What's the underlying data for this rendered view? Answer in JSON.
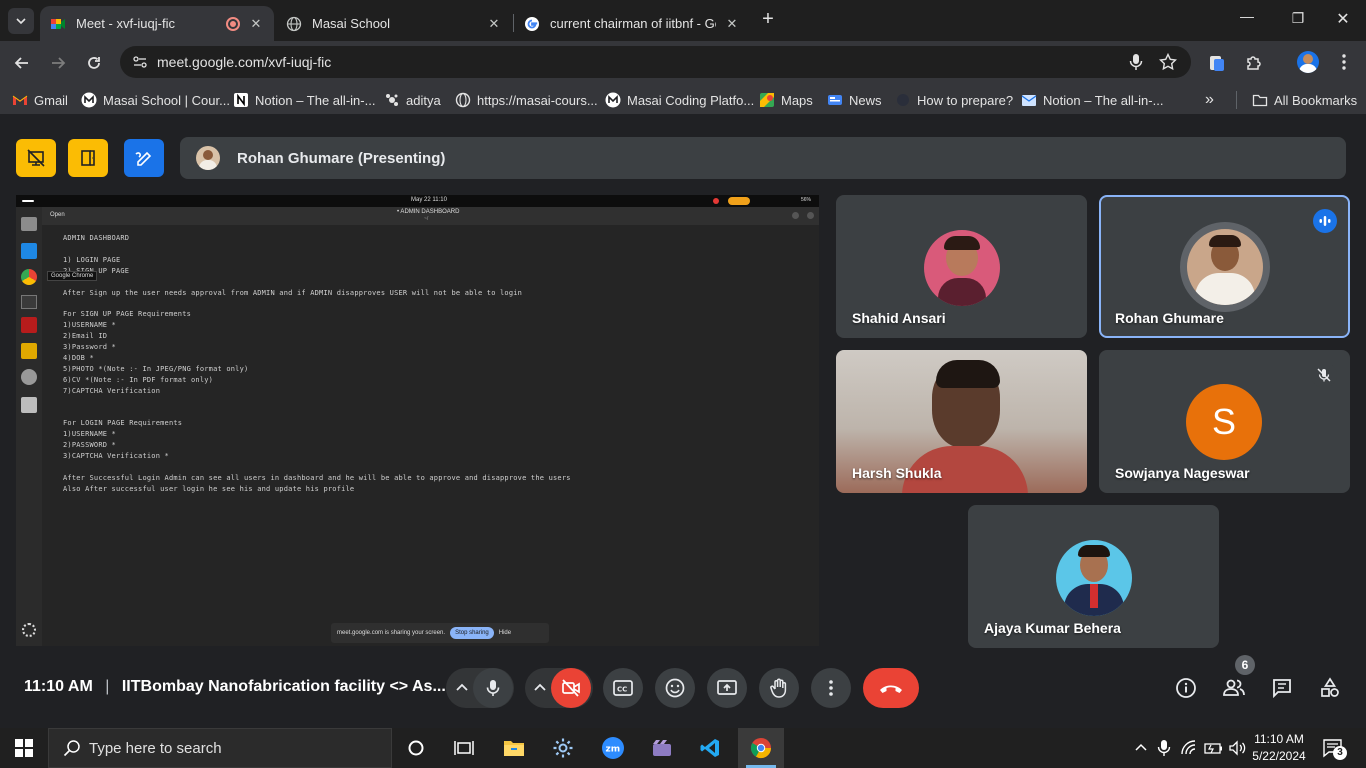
{
  "browser": {
    "tabs": [
      {
        "title": "Meet - xvf-iuqj-fic",
        "active": true,
        "recording": true
      },
      {
        "title": "Masai School",
        "active": false
      },
      {
        "title": "current chairman of iitbnf - Goo",
        "active": false
      }
    ],
    "new_tab": "+",
    "window_controls": {
      "minimize": "—",
      "restore": "❐",
      "close": "✕"
    },
    "url": "meet.google.com/xvf-iuqj-fic",
    "bookmarks": [
      {
        "label": "Gmail",
        "icon": "gmail-icon"
      },
      {
        "label": "Masai School | Cour...",
        "icon": "masai-icon"
      },
      {
        "label": "Notion – The all-in-...",
        "icon": "notion-icon"
      },
      {
        "label": "aditya",
        "icon": "aditya-icon"
      },
      {
        "label": "https://masai-cours...",
        "icon": "globe-icon"
      },
      {
        "label": "Masai Coding Platfo...",
        "icon": "masai-icon"
      },
      {
        "label": "Maps",
        "icon": "maps-icon"
      },
      {
        "label": "News",
        "icon": "news-icon"
      },
      {
        "label": "How to prepare?",
        "icon": "dark-circle-icon"
      },
      {
        "label": "Notion – The all-in-...",
        "icon": "mail-icon"
      }
    ],
    "bookmarks_overflow": "»",
    "all_bookmarks": "All Bookmarks"
  },
  "meet": {
    "presenter_label": "Rohan Ghumare (Presenting)",
    "shared_screen": {
      "os_clock": "May 22  11:10",
      "battery": "56%",
      "window_title": "• ADMIN DASHBOARD",
      "window_subtitle": "~/",
      "open_label": "Open",
      "tooltip": "Google Chrome",
      "lines": [
        "ADMIN DASHBOARD",
        "",
        "1) LOGIN PAGE",
        "2) SIGN UP PAGE",
        "",
        "After Sign up the user needs approval from ADMIN and if ADMIN disapproves USER will not be able to login",
        "",
        "For SIGN UP PAGE Requirements",
        "1)USERNAME *",
        "2)Email ID",
        "3)Password *",
        "4)DOB *",
        "5)PHOTO *(Note :- In JPEG/PNG format only)",
        "6)CV *(Note :- In PDF format only)",
        "7)CAPTCHA Verification",
        "",
        "",
        "For LOGIN PAGE Requirements",
        "1)USERNAME *",
        "2)PASSWORD *",
        "3)CAPTCHA Verification *",
        "",
        "After Successful Login Admin can see all users in dashboard and he will be able to approve and disapprove the users",
        "Also After successful user login he see his and update his profile"
      ],
      "sharing_notice": "meet.google.com is sharing your screen.",
      "stop_sharing": "Stop sharing",
      "hide": "Hide"
    },
    "participants": [
      {
        "name": "Shahid Ansari"
      },
      {
        "name": "Rohan Ghumare",
        "speaking": true
      },
      {
        "name": "Harsh Shukla"
      },
      {
        "name": "Sowjanya Nageswar",
        "initial": "S",
        "muted": true
      },
      {
        "name": "Ajaya Kumar Behera"
      }
    ],
    "time": "11:10 AM",
    "separator": "|",
    "meeting_title": "IITBombay Nanofabrication facility <> As...",
    "people_count": "6"
  },
  "taskbar": {
    "search_placeholder": "Type here to search",
    "clock_time": "11:10 AM",
    "clock_date": "5/22/2024",
    "notification_count": "3"
  },
  "colors": {
    "hangup": "#ea4335",
    "speaking_border": "#8ab4f8",
    "yellow_button": "#fbbc04",
    "blue_button": "#1a73e8",
    "sowjanya_avatar": "#e8710a"
  }
}
